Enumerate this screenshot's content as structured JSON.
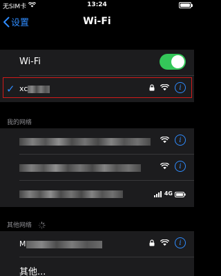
{
  "status_bar": {
    "carrier": "无SIM卡",
    "time": "13:24"
  },
  "nav": {
    "back_label": "设置",
    "title": "Wi-Fi"
  },
  "wifi_toggle": {
    "label": "Wi-Fi",
    "enabled": true
  },
  "connected_network": {
    "name_prefix": "xc",
    "secured": true
  },
  "my_networks": {
    "header": "我的网络",
    "items": [
      {
        "secured": false,
        "signal": "wifi",
        "hidden_name": true
      },
      {
        "secured": false,
        "signal": "wifi",
        "hidden_name": true
      },
      {
        "secured": false,
        "signal": "cellular",
        "cell_label": "4G",
        "hidden_name": true
      }
    ]
  },
  "other_networks": {
    "header": "其他网络",
    "items": [
      {
        "name_prefix": "M",
        "secured": true,
        "signal": "wifi"
      }
    ],
    "other_label": "其他..."
  },
  "colors": {
    "accent": "#2f8cff",
    "toggle_on": "#34c759",
    "highlight_box": "#d11a1a"
  }
}
